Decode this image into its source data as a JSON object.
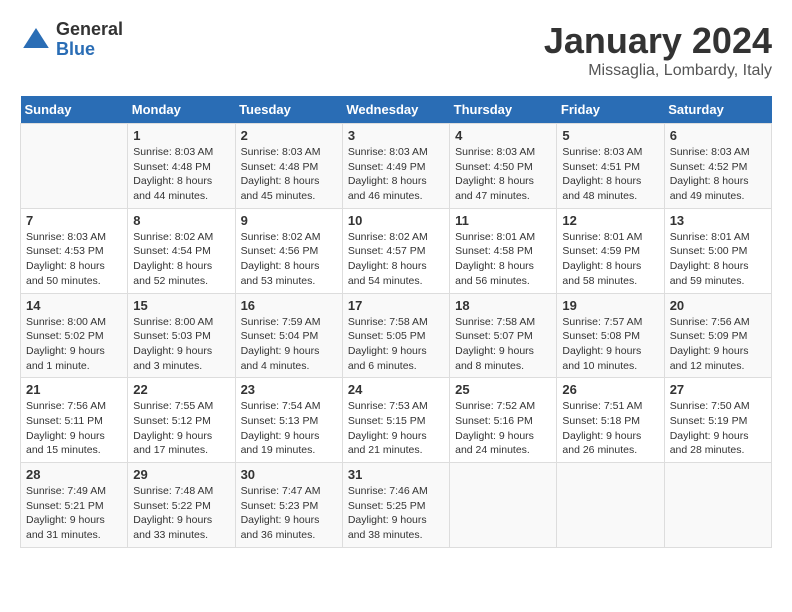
{
  "logo": {
    "general": "General",
    "blue": "Blue"
  },
  "title": "January 2024",
  "location": "Missaglia, Lombardy, Italy",
  "days_of_week": [
    "Sunday",
    "Monday",
    "Tuesday",
    "Wednesday",
    "Thursday",
    "Friday",
    "Saturday"
  ],
  "weeks": [
    [
      {
        "day": "",
        "sunrise": "",
        "sunset": "",
        "daylight": ""
      },
      {
        "day": "1",
        "sunrise": "Sunrise: 8:03 AM",
        "sunset": "Sunset: 4:48 PM",
        "daylight": "Daylight: 8 hours and 44 minutes."
      },
      {
        "day": "2",
        "sunrise": "Sunrise: 8:03 AM",
        "sunset": "Sunset: 4:48 PM",
        "daylight": "Daylight: 8 hours and 45 minutes."
      },
      {
        "day": "3",
        "sunrise": "Sunrise: 8:03 AM",
        "sunset": "Sunset: 4:49 PM",
        "daylight": "Daylight: 8 hours and 46 minutes."
      },
      {
        "day": "4",
        "sunrise": "Sunrise: 8:03 AM",
        "sunset": "Sunset: 4:50 PM",
        "daylight": "Daylight: 8 hours and 47 minutes."
      },
      {
        "day": "5",
        "sunrise": "Sunrise: 8:03 AM",
        "sunset": "Sunset: 4:51 PM",
        "daylight": "Daylight: 8 hours and 48 minutes."
      },
      {
        "day": "6",
        "sunrise": "Sunrise: 8:03 AM",
        "sunset": "Sunset: 4:52 PM",
        "daylight": "Daylight: 8 hours and 49 minutes."
      }
    ],
    [
      {
        "day": "7",
        "sunrise": "Sunrise: 8:03 AM",
        "sunset": "Sunset: 4:53 PM",
        "daylight": "Daylight: 8 hours and 50 minutes."
      },
      {
        "day": "8",
        "sunrise": "Sunrise: 8:02 AM",
        "sunset": "Sunset: 4:54 PM",
        "daylight": "Daylight: 8 hours and 52 minutes."
      },
      {
        "day": "9",
        "sunrise": "Sunrise: 8:02 AM",
        "sunset": "Sunset: 4:56 PM",
        "daylight": "Daylight: 8 hours and 53 minutes."
      },
      {
        "day": "10",
        "sunrise": "Sunrise: 8:02 AM",
        "sunset": "Sunset: 4:57 PM",
        "daylight": "Daylight: 8 hours and 54 minutes."
      },
      {
        "day": "11",
        "sunrise": "Sunrise: 8:01 AM",
        "sunset": "Sunset: 4:58 PM",
        "daylight": "Daylight: 8 hours and 56 minutes."
      },
      {
        "day": "12",
        "sunrise": "Sunrise: 8:01 AM",
        "sunset": "Sunset: 4:59 PM",
        "daylight": "Daylight: 8 hours and 58 minutes."
      },
      {
        "day": "13",
        "sunrise": "Sunrise: 8:01 AM",
        "sunset": "Sunset: 5:00 PM",
        "daylight": "Daylight: 8 hours and 59 minutes."
      }
    ],
    [
      {
        "day": "14",
        "sunrise": "Sunrise: 8:00 AM",
        "sunset": "Sunset: 5:02 PM",
        "daylight": "Daylight: 9 hours and 1 minute."
      },
      {
        "day": "15",
        "sunrise": "Sunrise: 8:00 AM",
        "sunset": "Sunset: 5:03 PM",
        "daylight": "Daylight: 9 hours and 3 minutes."
      },
      {
        "day": "16",
        "sunrise": "Sunrise: 7:59 AM",
        "sunset": "Sunset: 5:04 PM",
        "daylight": "Daylight: 9 hours and 4 minutes."
      },
      {
        "day": "17",
        "sunrise": "Sunrise: 7:58 AM",
        "sunset": "Sunset: 5:05 PM",
        "daylight": "Daylight: 9 hours and 6 minutes."
      },
      {
        "day": "18",
        "sunrise": "Sunrise: 7:58 AM",
        "sunset": "Sunset: 5:07 PM",
        "daylight": "Daylight: 9 hours and 8 minutes."
      },
      {
        "day": "19",
        "sunrise": "Sunrise: 7:57 AM",
        "sunset": "Sunset: 5:08 PM",
        "daylight": "Daylight: 9 hours and 10 minutes."
      },
      {
        "day": "20",
        "sunrise": "Sunrise: 7:56 AM",
        "sunset": "Sunset: 5:09 PM",
        "daylight": "Daylight: 9 hours and 12 minutes."
      }
    ],
    [
      {
        "day": "21",
        "sunrise": "Sunrise: 7:56 AM",
        "sunset": "Sunset: 5:11 PM",
        "daylight": "Daylight: 9 hours and 15 minutes."
      },
      {
        "day": "22",
        "sunrise": "Sunrise: 7:55 AM",
        "sunset": "Sunset: 5:12 PM",
        "daylight": "Daylight: 9 hours and 17 minutes."
      },
      {
        "day": "23",
        "sunrise": "Sunrise: 7:54 AM",
        "sunset": "Sunset: 5:13 PM",
        "daylight": "Daylight: 9 hours and 19 minutes."
      },
      {
        "day": "24",
        "sunrise": "Sunrise: 7:53 AM",
        "sunset": "Sunset: 5:15 PM",
        "daylight": "Daylight: 9 hours and 21 minutes."
      },
      {
        "day": "25",
        "sunrise": "Sunrise: 7:52 AM",
        "sunset": "Sunset: 5:16 PM",
        "daylight": "Daylight: 9 hours and 24 minutes."
      },
      {
        "day": "26",
        "sunrise": "Sunrise: 7:51 AM",
        "sunset": "Sunset: 5:18 PM",
        "daylight": "Daylight: 9 hours and 26 minutes."
      },
      {
        "day": "27",
        "sunrise": "Sunrise: 7:50 AM",
        "sunset": "Sunset: 5:19 PM",
        "daylight": "Daylight: 9 hours and 28 minutes."
      }
    ],
    [
      {
        "day": "28",
        "sunrise": "Sunrise: 7:49 AM",
        "sunset": "Sunset: 5:21 PM",
        "daylight": "Daylight: 9 hours and 31 minutes."
      },
      {
        "day": "29",
        "sunrise": "Sunrise: 7:48 AM",
        "sunset": "Sunset: 5:22 PM",
        "daylight": "Daylight: 9 hours and 33 minutes."
      },
      {
        "day": "30",
        "sunrise": "Sunrise: 7:47 AM",
        "sunset": "Sunset: 5:23 PM",
        "daylight": "Daylight: 9 hours and 36 minutes."
      },
      {
        "day": "31",
        "sunrise": "Sunrise: 7:46 AM",
        "sunset": "Sunset: 5:25 PM",
        "daylight": "Daylight: 9 hours and 38 minutes."
      },
      {
        "day": "",
        "sunrise": "",
        "sunset": "",
        "daylight": ""
      },
      {
        "day": "",
        "sunrise": "",
        "sunset": "",
        "daylight": ""
      },
      {
        "day": "",
        "sunrise": "",
        "sunset": "",
        "daylight": ""
      }
    ]
  ]
}
